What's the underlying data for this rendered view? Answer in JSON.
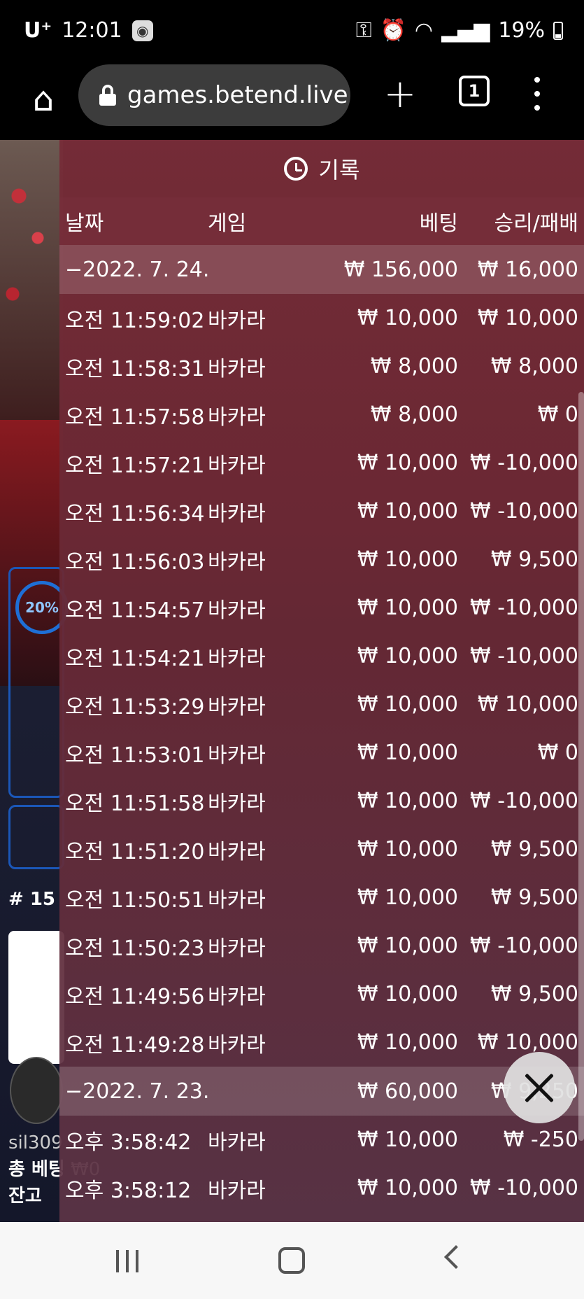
{
  "status_bar": {
    "carrier": "U⁺",
    "time": "12:01",
    "battery": "19%"
  },
  "browser": {
    "url": "games.betend.live",
    "tab_count": "1"
  },
  "background": {
    "progress_label": "20%",
    "round_label": "# 15",
    "username": "sil309",
    "total_bet_label": "총 베팅",
    "total_bet_value": "₩0",
    "balance_label": "잔고"
  },
  "history": {
    "title": "기록",
    "columns": {
      "date": "날짜",
      "game": "게임",
      "bet": "베팅",
      "win_loss": "승리/패배"
    },
    "groups": [
      {
        "date": "−2022. 7. 24.",
        "total_bet": "₩ 156,000",
        "total_win": "₩ 16,000",
        "rows": [
          {
            "time": "오전 11:59:02",
            "game": "바카라",
            "bet": "₩ 10,000",
            "win": "₩ 10,000"
          },
          {
            "time": "오전 11:58:31",
            "game": "바카라",
            "bet": "₩ 8,000",
            "win": "₩ 8,000"
          },
          {
            "time": "오전 11:57:58",
            "game": "바카라",
            "bet": "₩ 8,000",
            "win": "₩ 0"
          },
          {
            "time": "오전 11:57:21",
            "game": "바카라",
            "bet": "₩ 10,000",
            "win": "₩ -10,000"
          },
          {
            "time": "오전 11:56:34",
            "game": "바카라",
            "bet": "₩ 10,000",
            "win": "₩ -10,000"
          },
          {
            "time": "오전 11:56:03",
            "game": "바카라",
            "bet": "₩ 10,000",
            "win": "₩ 9,500"
          },
          {
            "time": "오전 11:54:57",
            "game": "바카라",
            "bet": "₩ 10,000",
            "win": "₩ -10,000"
          },
          {
            "time": "오전 11:54:21",
            "game": "바카라",
            "bet": "₩ 10,000",
            "win": "₩ -10,000"
          },
          {
            "time": "오전 11:53:29",
            "game": "바카라",
            "bet": "₩ 10,000",
            "win": "₩ 10,000"
          },
          {
            "time": "오전 11:53:01",
            "game": "바카라",
            "bet": "₩ 10,000",
            "win": "₩ 0"
          },
          {
            "time": "오전 11:51:58",
            "game": "바카라",
            "bet": "₩ 10,000",
            "win": "₩ -10,000"
          },
          {
            "time": "오전 11:51:20",
            "game": "바카라",
            "bet": "₩ 10,000",
            "win": "₩ 9,500"
          },
          {
            "time": "오전 11:50:51",
            "game": "바카라",
            "bet": "₩ 10,000",
            "win": "₩ 9,500"
          },
          {
            "time": "오전 11:50:23",
            "game": "바카라",
            "bet": "₩ 10,000",
            "win": "₩ -10,000"
          },
          {
            "time": "오전 11:49:56",
            "game": "바카라",
            "bet": "₩ 10,000",
            "win": "₩ 9,500"
          },
          {
            "time": "오전 11:49:28",
            "game": "바카라",
            "bet": "₩ 10,000",
            "win": "₩ 10,000"
          }
        ]
      },
      {
        "date": "−2022. 7. 23.",
        "total_bet": "₩ 60,000",
        "total_win": "₩ 9,250",
        "rows": [
          {
            "time": "오후 3:58:42",
            "game": "바카라",
            "bet": "₩ 10,000",
            "win": "₩ -250"
          },
          {
            "time": "오후 3:58:12",
            "game": "바카라",
            "bet": "₩ 10,000",
            "win": "₩ -10,000"
          }
        ]
      }
    ]
  }
}
